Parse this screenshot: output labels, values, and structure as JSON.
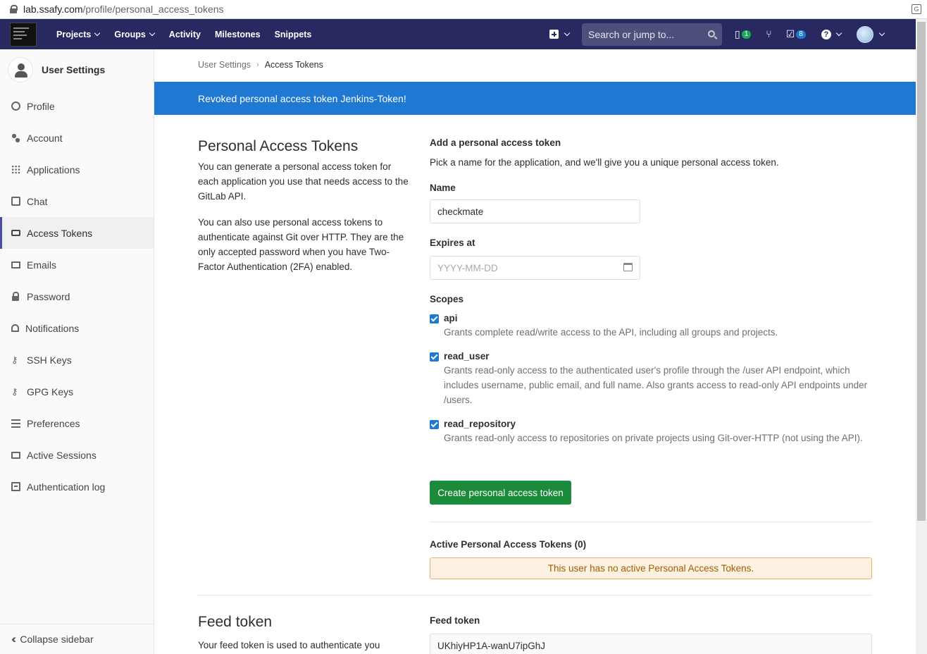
{
  "browser": {
    "url_host": "lab.ssafy.com",
    "url_path": "/profile/personal_access_tokens"
  },
  "topnav": {
    "items": [
      "Projects",
      "Groups",
      "Activity",
      "Milestones",
      "Snippets"
    ],
    "search_placeholder": "Search or jump to...",
    "issues_count": "1",
    "todos_count": "8",
    "badge_colors": {
      "issues": "#1aaa55",
      "todos": "#1f78d1"
    },
    "background": "#292961"
  },
  "sidebar": {
    "title": "User Settings",
    "items": [
      {
        "label": "Profile",
        "icon": "profile-icon"
      },
      {
        "label": "Account",
        "icon": "account-icon"
      },
      {
        "label": "Applications",
        "icon": "applications-icon"
      },
      {
        "label": "Chat",
        "icon": "chat-icon"
      },
      {
        "label": "Access Tokens",
        "icon": "token-icon",
        "active": true
      },
      {
        "label": "Emails",
        "icon": "mail-icon"
      },
      {
        "label": "Password",
        "icon": "lock-icon"
      },
      {
        "label": "Notifications",
        "icon": "bell-icon"
      },
      {
        "label": "SSH Keys",
        "icon": "key-icon"
      },
      {
        "label": "GPG Keys",
        "icon": "key-icon"
      },
      {
        "label": "Preferences",
        "icon": "sliders-icon"
      },
      {
        "label": "Active Sessions",
        "icon": "monitor-icon"
      },
      {
        "label": "Authentication log",
        "icon": "log-icon"
      }
    ],
    "collapse_label": "Collapse sidebar"
  },
  "breadcrumb": {
    "parent": "User Settings",
    "current": "Access Tokens"
  },
  "flash": {
    "message": "Revoked personal access token Jenkins-Token!",
    "color": "#1f78d1"
  },
  "pat": {
    "title": "Personal Access Tokens",
    "desc1": "You can generate a personal access token for each application you use that needs access to the GitLab API.",
    "desc2": "You can also use personal access tokens to authenticate against Git over HTTP. They are the only accepted password when you have Two-Factor Authentication (2FA) enabled.",
    "form_title": "Add a personal access token",
    "form_desc": "Pick a name for the application, and we'll give you a unique personal access token.",
    "name_label": "Name",
    "name_value": "checkmate",
    "expires_label": "Expires at",
    "expires_placeholder": "YYYY-MM-DD",
    "scopes_label": "Scopes",
    "scopes": [
      {
        "name": "api",
        "checked": true,
        "desc": "Grants complete read/write access to the API, including all groups and projects."
      },
      {
        "name": "read_user",
        "checked": true,
        "desc": "Grants read-only access to the authenticated user's profile through the /user API endpoint, which includes username, public email, and full name. Also grants access to read-only API endpoints under /users."
      },
      {
        "name": "read_repository",
        "checked": true,
        "desc": "Grants read-only access to repositories on private projects using Git-over-HTTP (not using the API)."
      }
    ],
    "create_button": "Create personal access token",
    "active_title": "Active Personal Access Tokens (0)",
    "no_tokens": "This user has no active Personal Access Tokens."
  },
  "feed": {
    "title": "Feed token",
    "desc": "Your feed token is used to authenticate you",
    "label": "Feed token",
    "value": "UKhiyHP1A-wanU7ipGhJ"
  }
}
